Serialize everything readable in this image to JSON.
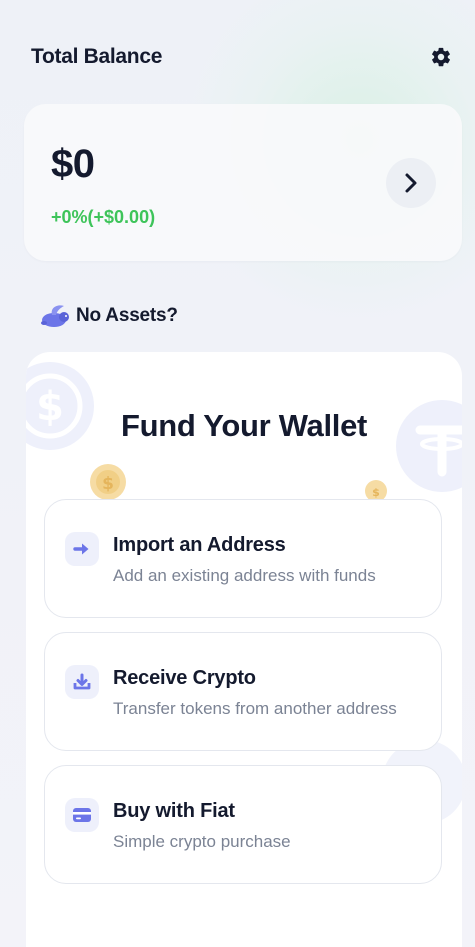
{
  "header": {
    "title": "Total Balance",
    "settings_icon": "gear-icon"
  },
  "balance": {
    "amount": "$0",
    "change": "+0%(+$0.00)",
    "change_color": "#3ec45a",
    "details_icon": "chevron-right-icon"
  },
  "empty_state": {
    "label": "No Assets?",
    "icon": "rabbit-icon"
  },
  "fund": {
    "title": "Fund Your Wallet",
    "options": [
      {
        "title": "Import an Address",
        "subtitle": "Add an existing address with funds",
        "icon": "arrow-right-icon"
      },
      {
        "title": "Receive Crypto",
        "subtitle": "Transfer tokens from another address",
        "icon": "download-tray-icon"
      },
      {
        "title": "Buy with Fiat",
        "subtitle": "Simple crypto purchase",
        "icon": "credit-card-icon"
      }
    ]
  },
  "colors": {
    "accent": "#6c75e8",
    "text": "#141a2e",
    "muted": "#7b8394",
    "positive": "#3ec45a"
  }
}
